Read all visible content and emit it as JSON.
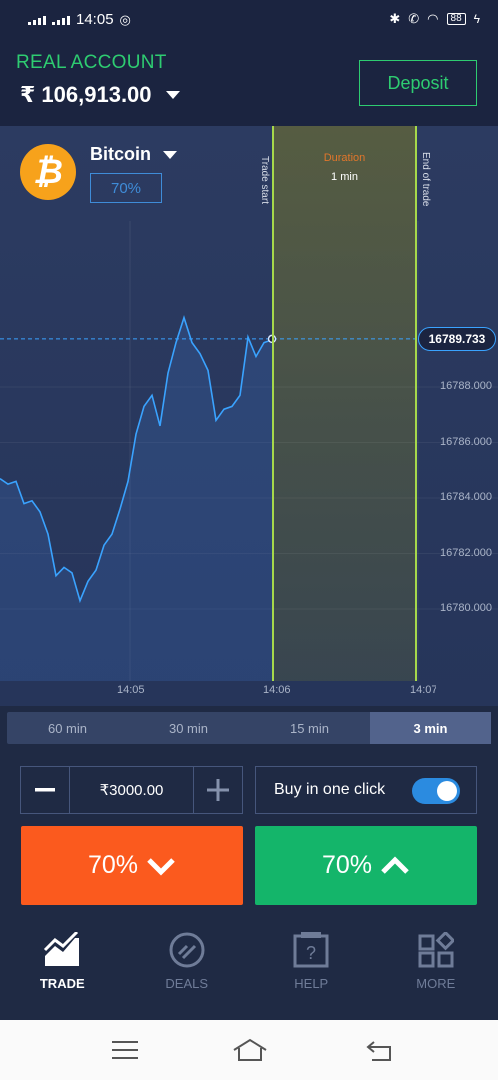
{
  "status": {
    "time": "14:05",
    "battery": "88"
  },
  "account": {
    "label": "REAL ACCOUNT",
    "balance": "₹ 106,913.00",
    "deposit_label": "Deposit"
  },
  "asset": {
    "name": "Bitcoin",
    "payout": "70%",
    "icon": "bitcoin-icon"
  },
  "chart_overlay": {
    "trade_start": "Trade start",
    "end_of_trade": "End of trade",
    "duration_label": "Duration",
    "duration_value": "1 min",
    "current_price": "16789.733"
  },
  "chart_data": {
    "type": "line",
    "x_ticks": [
      "14:05",
      "14:06",
      "14:07"
    ],
    "y_ticks": [
      "16788.000",
      "16786.000",
      "16784.000",
      "16782.000",
      "16780.000"
    ],
    "ylim": [
      16779,
      16791.5
    ],
    "series": [
      {
        "values": [
          16784.7,
          16784.5,
          16784.6,
          16783.8,
          16783.9,
          16783.5,
          16782.7,
          16781.2,
          16781.5,
          16781.3,
          16780.3,
          16781.0,
          16781.4,
          16782.3,
          16782.7,
          16783.6,
          16784.6,
          16786.3,
          16787.3,
          16787.7,
          16786.6,
          16788.5,
          16789.6,
          16790.5,
          16789.6,
          16789.2,
          16788.6,
          16786.8,
          16787.2,
          16787.3,
          16787.7,
          16789.8,
          16789.1,
          16789.6,
          16789.7
        ]
      }
    ]
  },
  "timeframes": [
    "60 min",
    "30 min",
    "15 min",
    "3 min"
  ],
  "active_timeframe": "3 min",
  "amount": {
    "value": "₹3000.00",
    "minus_icon": "minus-icon",
    "plus_icon": "plus-icon"
  },
  "one_click": {
    "label": "Buy in one click",
    "enabled": true
  },
  "put": {
    "label": "70%",
    "color": "#fb5a1e"
  },
  "call": {
    "label": "70%",
    "color": "#14b56a"
  },
  "nav": [
    {
      "label": "TRADE",
      "icon": "trade-chart-icon",
      "active": true
    },
    {
      "label": "DEALS",
      "icon": "deals-icon",
      "active": false
    },
    {
      "label": "HELP",
      "icon": "help-icon",
      "active": false
    },
    {
      "label": "MORE",
      "icon": "more-icon",
      "active": false
    }
  ],
  "colors": {
    "background": "#1f2a44",
    "accent_green": "#2ecc71",
    "accent_blue": "#3aa3ff"
  }
}
